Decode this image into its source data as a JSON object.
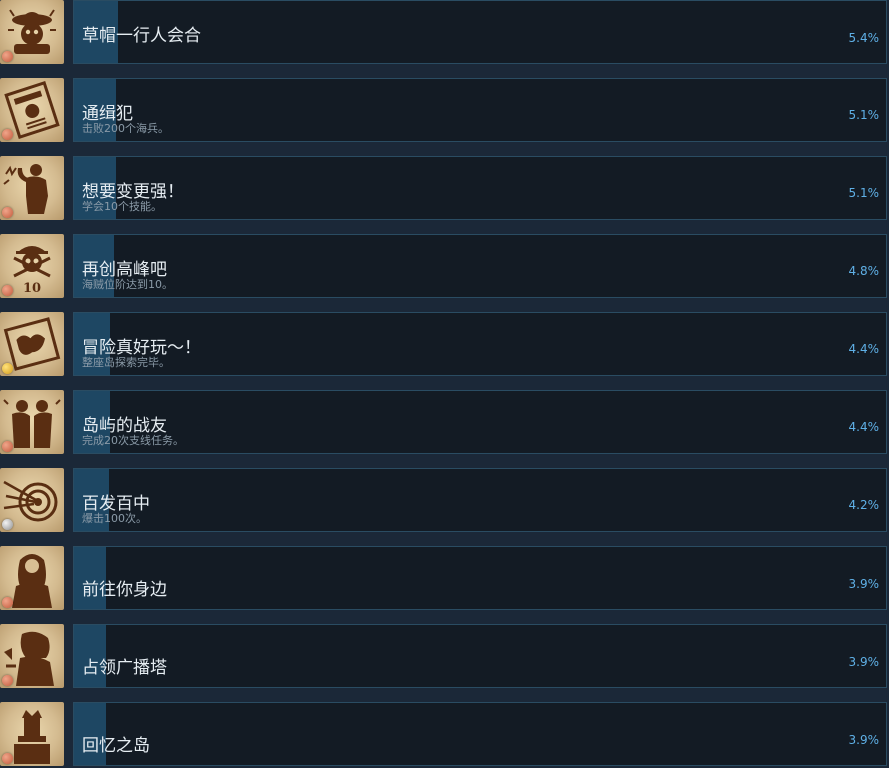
{
  "achievements": [
    {
      "title": "草帽一行人会合",
      "desc": "",
      "percent_label": "5.4%",
      "percent": 5.4,
      "medal": "bronze",
      "icon": "straw-hat-crew-icon"
    },
    {
      "title": "通缉犯",
      "desc": "击败200个海兵。",
      "percent_label": "5.1%",
      "percent": 5.1,
      "medal": "bronze",
      "icon": "wanted-poster-icon"
    },
    {
      "title": "想要变更强！",
      "desc": "学会10个技能。",
      "percent_label": "5.1%",
      "percent": 5.1,
      "medal": "bronze",
      "icon": "flexing-fighter-icon"
    },
    {
      "title": "再创高峰吧",
      "desc": "海贼位阶达到10。",
      "percent_label": "4.8%",
      "percent": 4.8,
      "medal": "bronze",
      "icon": "jolly-roger-icon",
      "icon_text": "10"
    },
    {
      "title": "冒险真好玩～！",
      "desc": "整座岛探索完毕。",
      "percent_label": "4.4%",
      "percent": 4.4,
      "medal": "gold",
      "icon": "island-map-icon"
    },
    {
      "title": "岛屿的战友",
      "desc": "完成20次支线任务。",
      "percent_label": "4.4%",
      "percent": 4.4,
      "medal": "bronze",
      "icon": "comrades-icon"
    },
    {
      "title": "百发百中",
      "desc": "爆击100次。",
      "percent_label": "4.2%",
      "percent": 4.2,
      "medal": "silver",
      "icon": "bullseye-target-icon"
    },
    {
      "title": "前往你身边",
      "desc": "",
      "percent_label": "3.9%",
      "percent": 3.9,
      "medal": "bronze",
      "icon": "girl-silhouette-icon"
    },
    {
      "title": "占领广播塔",
      "desc": "",
      "percent_label": "3.9%",
      "percent": 3.9,
      "medal": "bronze",
      "icon": "broadcast-speaker-icon"
    },
    {
      "title": "回忆之岛",
      "desc": "",
      "percent_label": "3.9%",
      "percent": 3.9,
      "medal": "bronze",
      "icon": "memorial-statue-icon"
    }
  ],
  "colors": {
    "background": "#1b2838",
    "panel": "#131b24",
    "panel_border": "#2a4c62",
    "progress_fill": "#1e4763",
    "title_text": "#e6edf2",
    "desc_text": "#8b9ba8",
    "percent_text": "#5fb0e6",
    "icon_ink": "#5a2e12"
  }
}
